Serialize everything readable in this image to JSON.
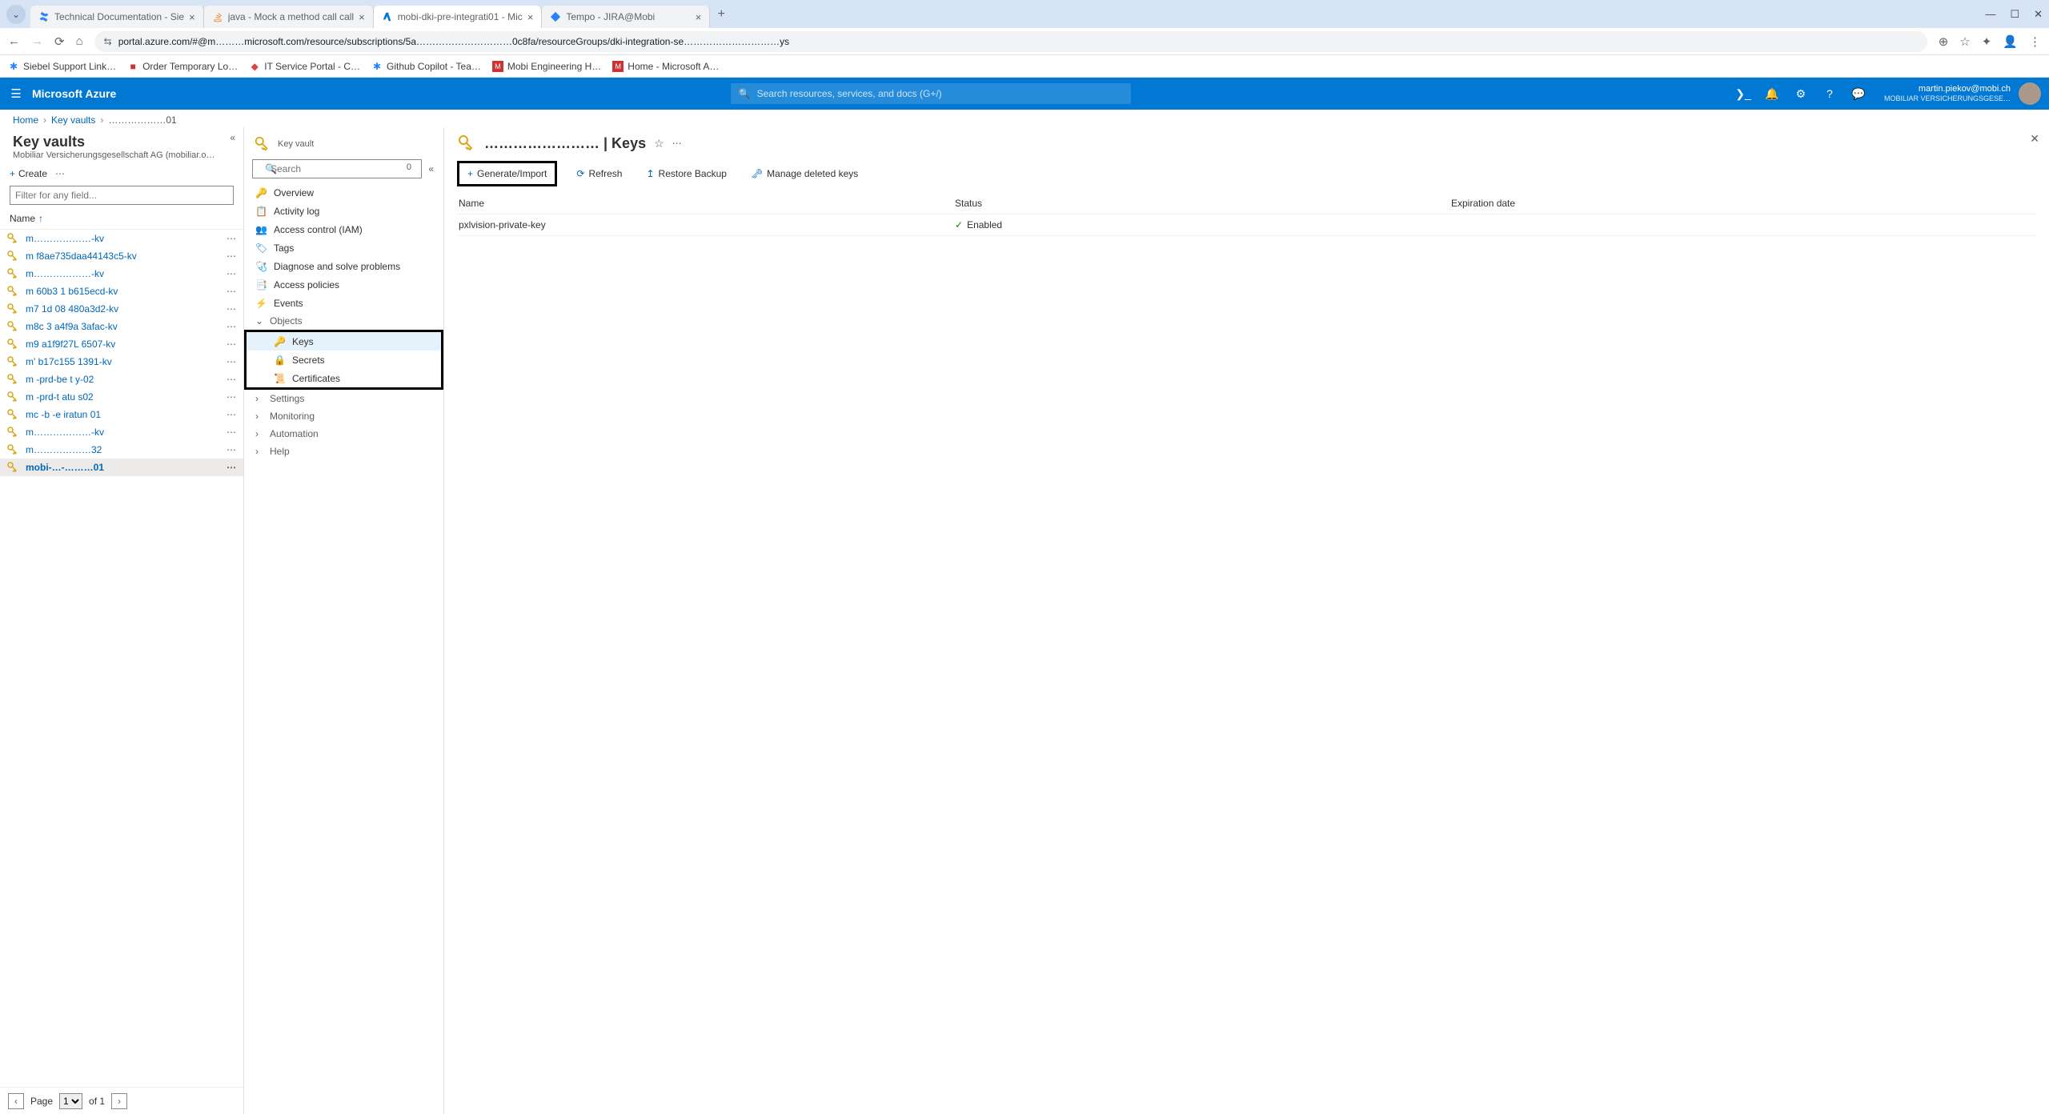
{
  "browser": {
    "tabs": [
      {
        "title": "Technical Documentation - Sie",
        "favicon": "confluence"
      },
      {
        "title": "java - Mock a method call call",
        "favicon": "stackoverflow"
      },
      {
        "title": "mobi-dki-pre-integrati01 - Mic",
        "favicon": "azure",
        "active": true
      },
      {
        "title": "Tempo - JIRA@Mobi",
        "favicon": "jira"
      }
    ],
    "url": "portal.azure.com/#@m………microsoft.com/resource/subscriptions/5a…………………………0c8fa/resourceGroups/dki-integration-se…………………………ys",
    "bookmarks": [
      "Siebel Support Link…",
      "Order Temporary Lo…",
      "IT Service Portal - C…",
      "Github Copilot - Tea…",
      "Mobi Engineering H…",
      "Home - Microsoft A…"
    ]
  },
  "azure": {
    "brand": "Microsoft Azure",
    "search_placeholder": "Search resources, services, and docs (G+/)",
    "account": {
      "email": "martin.piekov@mobi.ch",
      "org": "MOBILIAR VERSICHERUNGSGESE…"
    }
  },
  "breadcrumb": {
    "home": "Home",
    "kv": "Key vaults",
    "res": "………………01"
  },
  "left": {
    "title": "Key vaults",
    "org": "Mobiliar Versicherungsgesellschaft AG (mobiliar.o…",
    "create": "Create",
    "filter_placeholder": "Filter for any field...",
    "col_name": "Name",
    "pager": {
      "page_label": "Page",
      "page": "1",
      "of_text": "of 1"
    },
    "items": [
      "m………………-kv",
      "m   f8ae735daa44143c5-kv",
      "m………………-kv",
      "m   60b3   1   b615ecd-kv",
      "m7   1d   08   480a3d2-kv",
      "m8c   3   a4f9a   3afac-kv",
      "m9   a1f9f27L   6507-kv",
      "m'   b17c155   1391-kv",
      "m   -prd-be   t   y-02",
      "m   -prd-t   atu   s02",
      "mc   -b   -e   iratun   01",
      "m………………-kv",
      "m………………32",
      "mobi-…-………01"
    ],
    "selected_index": 13
  },
  "resnav": {
    "res_type": "Key vault",
    "search_placeholder": "Search",
    "search_count": "0",
    "items": {
      "overview": "Overview",
      "activity": "Activity log",
      "iam": "Access control (IAM)",
      "tags": "Tags",
      "diagnose": "Diagnose and solve problems",
      "policies": "Access policies",
      "events": "Events"
    },
    "groups": {
      "objects": "Objects",
      "settings": "Settings",
      "monitoring": "Monitoring",
      "automation": "Automation",
      "help": "Help"
    },
    "objects": {
      "keys": "Keys",
      "secrets": "Secrets",
      "certificates": "Certificates"
    }
  },
  "content": {
    "title_suffix": " | Keys",
    "title_prefix": "…………………… ",
    "toolbar": {
      "generate": "Generate/Import",
      "refresh": "Refresh",
      "restore": "Restore Backup",
      "manage_deleted": "Manage deleted keys"
    },
    "columns": {
      "name": "Name",
      "status": "Status",
      "expiration": "Expiration date"
    },
    "rows": [
      {
        "name": "pxlvision-private-key",
        "status": "Enabled",
        "expiration": ""
      }
    ]
  }
}
